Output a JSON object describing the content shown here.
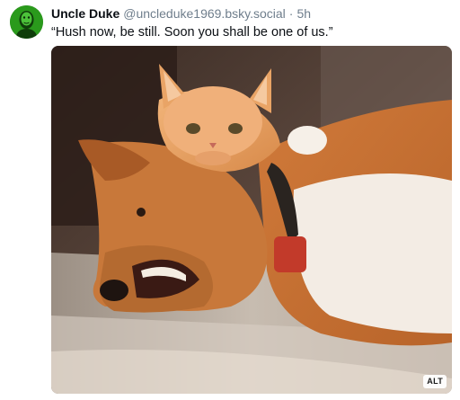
{
  "post": {
    "author": {
      "display_name": "Uncle Duke",
      "handle": "@uncleduke1969.bsky.social",
      "avatar_icon": "avatar-image"
    },
    "separator": "·",
    "timestamp": "5h",
    "text": "“Hush now, be still. Soon you shall be one of us.”",
    "media": {
      "alt_badge": "ALT",
      "description_icon": "cat-biting-dog-photo"
    }
  },
  "colors": {
    "name": "#0b0f14",
    "muted": "#6f7e8c",
    "avatar_green": "#1f8a1f"
  }
}
